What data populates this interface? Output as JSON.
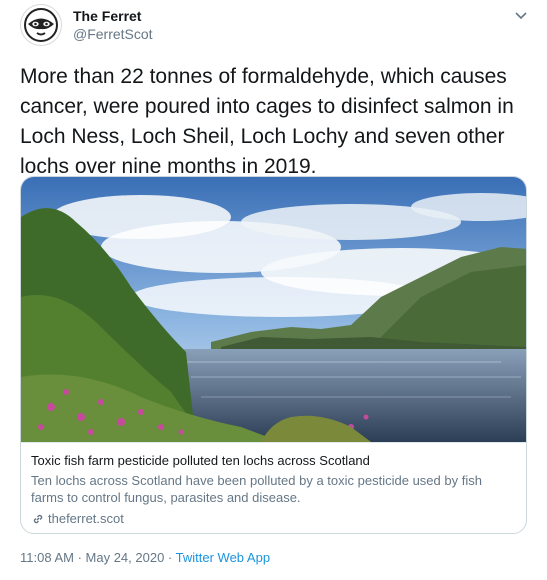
{
  "tweet": {
    "display_name": "The Ferret",
    "handle": "@FerretScot",
    "text": "More than 22 tonnes of formaldehyde, which causes cancer, were poured into cages to disinfect salmon in Loch Ness, Loch Sheil, Loch Lochy and seven other lochs over nine months in 2019."
  },
  "card": {
    "title": "Toxic fish farm pesticide polluted ten lochs across Scotland",
    "description": "Ten lochs across Scotland have been polluted by a toxic pesticide used by fish farms to control fungus, parasites and disease.",
    "domain": "theferret.scot"
  },
  "meta": {
    "time": "11:08 AM",
    "separator": " · ",
    "date": "May 24, 2020",
    "separator2": " · ",
    "app": "Twitter Web App"
  },
  "icons": {
    "avatar": "ferret-logo-icon",
    "caret": "chevron-down-icon",
    "link": "link-icon"
  },
  "colors": {
    "link_blue": "#1b95e0",
    "muted": "#657786",
    "text": "#14171a",
    "border": "#ccd6dd"
  }
}
